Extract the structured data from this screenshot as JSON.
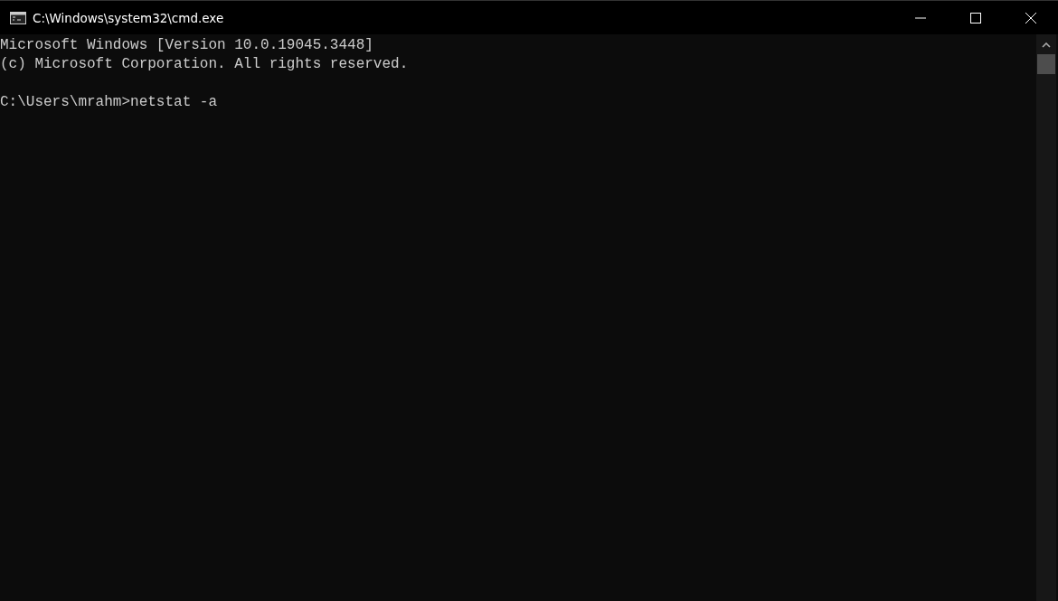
{
  "window": {
    "title": "C:\\Windows\\system32\\cmd.exe"
  },
  "console": {
    "output": [
      "Microsoft Windows [Version 10.0.19045.3448]",
      "(c) Microsoft Corporation. All rights reserved."
    ],
    "prompt_line": "C:\\Users\\mrahm>netstat -a"
  }
}
